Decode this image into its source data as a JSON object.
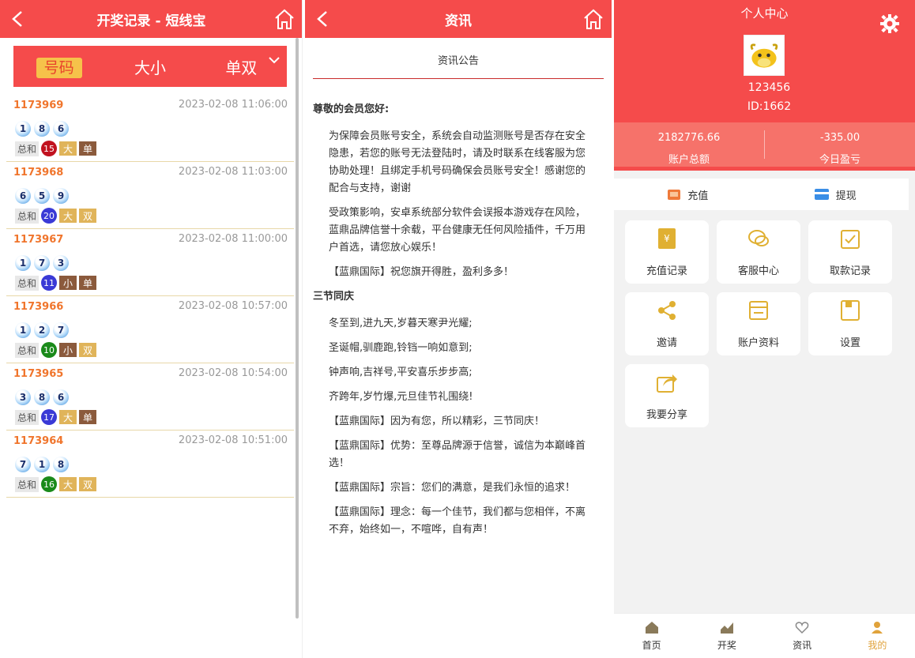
{
  "colors": {
    "header_red": "#f54b4b",
    "issue_orange": "#f0752c",
    "gold": "#e0b45a",
    "brown": "#8b5a3c"
  },
  "history": {
    "title": "开奖记录 - 短线宝",
    "tabs": [
      "号码",
      "大小",
      "单双"
    ],
    "records": [
      {
        "issue": "1173969",
        "time": "2023-02-08 11:06:00",
        "balls": [
          "1",
          "8",
          "6"
        ],
        "sum_label": "总和",
        "sum": "15",
        "sum_color": "#c1121f",
        "size": "大",
        "parity": "单"
      },
      {
        "issue": "1173968",
        "time": "2023-02-08 11:03:00",
        "balls": [
          "6",
          "5",
          "9"
        ],
        "sum_label": "总和",
        "sum": "20",
        "sum_color": "#3a3ad6",
        "size": "大",
        "parity": "双"
      },
      {
        "issue": "1173967",
        "time": "2023-02-08 11:00:00",
        "balls": [
          "1",
          "7",
          "3"
        ],
        "sum_label": "总和",
        "sum": "11",
        "sum_color": "#3a3ad6",
        "size": "小",
        "parity": "单"
      },
      {
        "issue": "1173966",
        "time": "2023-02-08 10:57:00",
        "balls": [
          "1",
          "2",
          "7"
        ],
        "sum_label": "总和",
        "sum": "10",
        "sum_color": "#1a8a1a",
        "size": "小",
        "parity": "双"
      },
      {
        "issue": "1173965",
        "time": "2023-02-08 10:54:00",
        "balls": [
          "3",
          "8",
          "6"
        ],
        "sum_label": "总和",
        "sum": "17",
        "sum_color": "#3a3ad6",
        "size": "大",
        "parity": "单"
      },
      {
        "issue": "1173964",
        "time": "2023-02-08 10:51:00",
        "balls": [
          "7",
          "1",
          "8"
        ],
        "sum_label": "总和",
        "sum": "16",
        "sum_color": "#1a8a1a",
        "size": "大",
        "parity": "双"
      }
    ]
  },
  "news": {
    "title": "资讯",
    "tab": "资讯公告",
    "greeting": "尊敬的会员您好:",
    "paras1": [
      "为保障会员账号安全，系统会自动监测账号是否存在安全隐患，若您的账号无法登陆时，请及时联系在线客服为您协助处理！且绑定手机号码确保会员账号安全！感谢您的配合与支持，谢谢",
      "受政策影响，安卓系统部分软件会误报本游戏存在风险，蓝鼎品牌信誉十余载，平台健康无任何风险插件，千万用户首选，请您放心娱乐！",
      "【蓝鼎国际】祝您旗开得胜，盈利多多！"
    ],
    "heading2": "三节同庆",
    "paras2": [
      "冬至到,进九天,岁暮天寒尹光耀;",
      "圣诞帽,驯鹿跑,铃铛一响如意到;",
      "钟声响,吉祥号,平安喜乐步步高;",
      "齐跨年,岁竹爆,元旦佳节礼围绕!",
      "【蓝鼎国际】因为有您，所以精彩，三节同庆！",
      "【蓝鼎国际】优势：至尊品牌源于信誉，诚信为本巅峰首选！",
      "【蓝鼎国际】宗旨：您们的满意，是我们永恒的追求！",
      "【蓝鼎国际】理念：每一个佳节，我们都与您相伴，不离不弃，始终如一，不喧哗，自有声！"
    ]
  },
  "profile": {
    "title": "个人中心",
    "username": "123456",
    "user_id": "ID:1662",
    "balance_value": "2182776.66",
    "balance_label": "账户总额",
    "profit_value": "-335.00",
    "profit_label": "今日盈亏",
    "recharge": "充值",
    "withdraw": "提现",
    "grid": [
      "充值记录",
      "客服中心",
      "取款记录",
      "邀请",
      "账户资料",
      "设置",
      "我要分享"
    ],
    "tabbar": [
      "首页",
      "开奖",
      "资讯",
      "我的"
    ]
  }
}
